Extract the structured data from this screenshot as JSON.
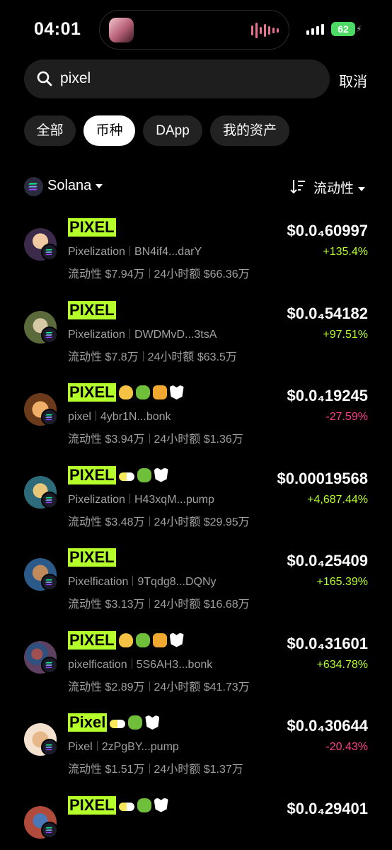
{
  "status": {
    "time": "04:01",
    "battery": "62"
  },
  "search": {
    "query": "pixel",
    "cancel_label": "取消"
  },
  "tabs": [
    {
      "label": "全部",
      "active": false
    },
    {
      "label": "币种",
      "active": true
    },
    {
      "label": "DApp",
      "active": false
    },
    {
      "label": "我的资产",
      "active": false
    }
  ],
  "filters": {
    "chain": "Solana",
    "sort": "流动性"
  },
  "colors": {
    "highlight": "#b5ff2b",
    "up": "#b5ff2b",
    "down": "#ff3b8d"
  },
  "tokens": [
    {
      "name": "PIXEL",
      "full_name": "Pixelization",
      "address": "BN4if4...darY",
      "liquidity": "流动性 $7.94万",
      "volume": "24小时额 $66.36万",
      "price": "$0.0₄60997",
      "change": "+135.4%",
      "direction": "up",
      "badges": []
    },
    {
      "name": "PIXEL",
      "full_name": "Pixelization",
      "address": "DWDMvD...3tsA",
      "liquidity": "流动性 $7.8万",
      "volume": "24小时额 $63.5万",
      "price": "$0.0₄54182",
      "change": "+97.51%",
      "direction": "up",
      "badges": []
    },
    {
      "name": "PIXEL",
      "full_name": "pixel",
      "address": "4ybr1N...bonk",
      "liquidity": "流动性 $3.94万",
      "volume": "24小时额 $1.36万",
      "price": "$0.0₄19245",
      "change": "-27.59%",
      "direction": "down",
      "badges": [
        "hand-icon",
        "money-bag-icon",
        "people-icon",
        "owl-icon"
      ]
    },
    {
      "name": "PIXEL",
      "full_name": "Pixelization",
      "address": "H43xqM...pump",
      "liquidity": "流动性 $3.48万",
      "volume": "24小时额 $29.95万",
      "price": "$0.00019568",
      "change": "+4,687.44%",
      "direction": "up",
      "badges": [
        "pill-icon",
        "money-bag-icon",
        "owl-icon"
      ]
    },
    {
      "name": "PIXEL",
      "full_name": "Pixelfication",
      "address": "9Tqdg8...DQNy",
      "liquidity": "流动性 $3.13万",
      "volume": "24小时额 $16.68万",
      "price": "$0.0₄25409",
      "change": "+165.39%",
      "direction": "up",
      "badges": []
    },
    {
      "name": "PIXEL",
      "full_name": "pixelfication",
      "address": "5S6AH3...bonk",
      "liquidity": "流动性 $2.89万",
      "volume": "24小时额 $41.73万",
      "price": "$0.0₄31601",
      "change": "+634.78%",
      "direction": "up",
      "badges": [
        "hand-icon",
        "money-bag-icon",
        "people-icon",
        "owl-icon"
      ]
    },
    {
      "name": "Pixel",
      "full_name": "Pixel",
      "address": "2zPgBY...pump",
      "liquidity": "流动性 $1.51万",
      "volume": "24小时额 $1.37万",
      "price": "$0.0₄30644",
      "change": "-20.43%",
      "direction": "down",
      "badges": [
        "pill-icon",
        "money-bag-icon",
        "owl-icon"
      ]
    },
    {
      "name": "PIXEL",
      "full_name": "",
      "address": "",
      "liquidity": "",
      "volume": "",
      "price": "$0.0₄29401",
      "change": "",
      "direction": "up",
      "badges": [
        "pill-icon",
        "money-bag-icon",
        "owl-icon"
      ]
    }
  ]
}
